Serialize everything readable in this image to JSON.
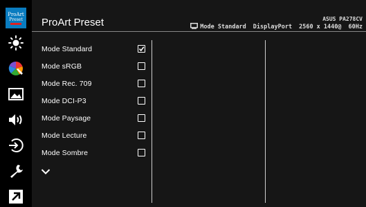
{
  "logo": {
    "line1": "ProArt",
    "line2": "Preset"
  },
  "sidebar": {
    "items": [
      {
        "icon": "logo-icon"
      },
      {
        "icon": "brightness-icon"
      },
      {
        "icon": "color-icon"
      },
      {
        "icon": "image-icon"
      },
      {
        "icon": "sound-icon"
      },
      {
        "icon": "input-select-icon"
      },
      {
        "icon": "system-setup-icon"
      },
      {
        "icon": "shortcut-icon"
      }
    ]
  },
  "header": {
    "title": "ProArt Preset",
    "model": "ASUS PA278CV",
    "mode": "Mode Standard",
    "input": "DisplayPort",
    "resolution": "2560 x 1440@",
    "refresh": "60Hz"
  },
  "options": [
    {
      "label": "Mode Standard",
      "checked": true
    },
    {
      "label": "Mode sRGB",
      "checked": false
    },
    {
      "label": "Mode Rec. 709",
      "checked": false
    },
    {
      "label": "Mode DCI-P3",
      "checked": false
    },
    {
      "label": "Mode Paysage",
      "checked": false
    },
    {
      "label": "Mode Lecture",
      "checked": false
    },
    {
      "label": "Mode Sombre",
      "checked": false
    }
  ],
  "colors": {
    "accent": "#0a7cc0",
    "background": "#161616"
  }
}
